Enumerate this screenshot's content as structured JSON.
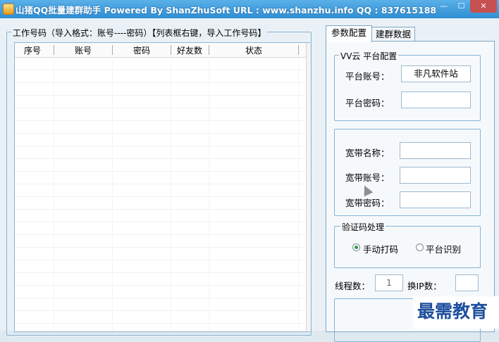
{
  "window": {
    "title": "山猪QQ批量建群助手  Powered By ShanZhuSoft  URL : www.shanzhu.info  QQ : 837615188",
    "min": "—",
    "max": "☐",
    "close": "✕"
  },
  "list_group": {
    "title": "工作号码（导入格式：账号----密码）【列表框右键，导入工作号码】",
    "columns": [
      "序号",
      "账号",
      "密码",
      "好友数",
      "状态"
    ],
    "rows": []
  },
  "tabs": [
    "参数配置",
    "建群数据"
  ],
  "platform_group": {
    "title": "VV云  平台配置",
    "account_label": "平台账号：",
    "account_value": "非凡软件站",
    "password_label": "平台密码：",
    "password_value": ""
  },
  "broadband_group": {
    "name_label": "宽带名称：",
    "name_value": "",
    "account_label": "宽带账号：",
    "account_value": "",
    "password_label": "宽带密码：",
    "password_value": ""
  },
  "captcha_group": {
    "title": "验证码处理",
    "options": [
      {
        "label": "手动打码",
        "selected": true
      },
      {
        "label": "平台识别",
        "selected": false
      }
    ]
  },
  "threads": {
    "label": "线程数：",
    "value": "1",
    "ip_label": "换IP数：",
    "ip_value": ""
  },
  "watermark": "最需教育"
}
